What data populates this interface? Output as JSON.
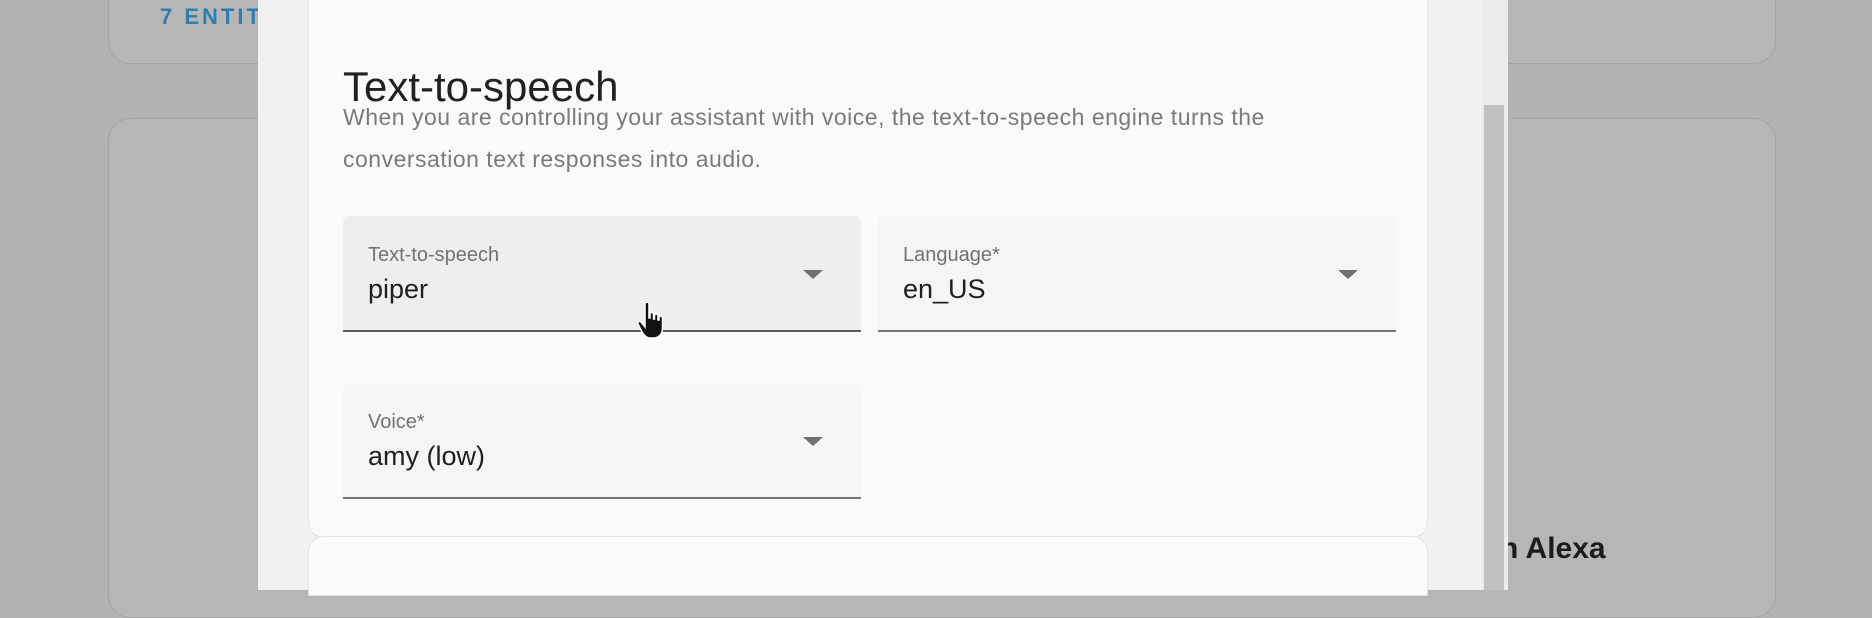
{
  "background": {
    "entities_link": "7 ENTIT",
    "card_text": "n Alexa"
  },
  "dialog": {
    "section": {
      "title": "Text-to-speech",
      "description": "When you are controlling your assistant with voice, the text-to-speech engine turns the conversation text responses into audio."
    },
    "fields": {
      "tts": {
        "label": "Text-to-speech",
        "value": "piper",
        "icon": "chevron-down-icon"
      },
      "language": {
        "label": "Language*",
        "value": "en_US",
        "icon": "chevron-down-icon"
      },
      "voice": {
        "label": "Voice*",
        "value": "amy (low)",
        "icon": "chevron-down-icon"
      }
    }
  },
  "cursor": {
    "type": "hand-pointer"
  },
  "colors": {
    "overlay": "#b3b3b3",
    "surface": "#fafafa",
    "field_bg": "#f5f5f5",
    "link": "#2c7fb0"
  }
}
